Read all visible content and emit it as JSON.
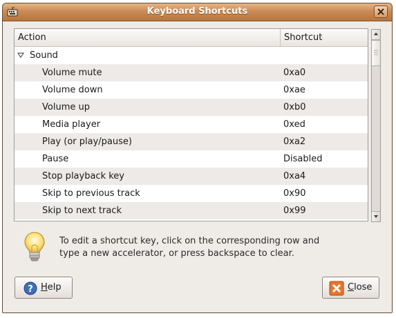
{
  "window": {
    "title": "Keyboard Shortcuts"
  },
  "tree": {
    "columns": {
      "action": "Action",
      "shortcut": "Shortcut"
    },
    "group": {
      "label": "Sound",
      "expanded": true
    },
    "rows": [
      {
        "action": "Volume mute",
        "shortcut": "0xa0"
      },
      {
        "action": "Volume down",
        "shortcut": "0xae"
      },
      {
        "action": "Volume up",
        "shortcut": "0xb0"
      },
      {
        "action": "Media player",
        "shortcut": "0xed"
      },
      {
        "action": "Play (or play/pause)",
        "shortcut": "0xa2"
      },
      {
        "action": "Pause",
        "shortcut": "Disabled"
      },
      {
        "action": "Stop playback key",
        "shortcut": "0xa4"
      },
      {
        "action": "Skip to previous track",
        "shortcut": "0x90"
      },
      {
        "action": "Skip to next track",
        "shortcut": "0x99"
      }
    ]
  },
  "hint": {
    "line1": "To edit a shortcut key, click on the corresponding row and",
    "line2": "type a new accelerator, or press backspace to clear.",
    "icon": "lightbulb-icon"
  },
  "buttons": {
    "help": {
      "mnemonic": "H",
      "rest": "elp",
      "icon": "help-icon"
    },
    "close": {
      "mnemonic": "C",
      "rest": "lose",
      "icon": "close-icon"
    }
  },
  "colors": {
    "titlebar": "#c98b57",
    "window_bg": "#efebe7",
    "alt_row": "#edeae7"
  }
}
